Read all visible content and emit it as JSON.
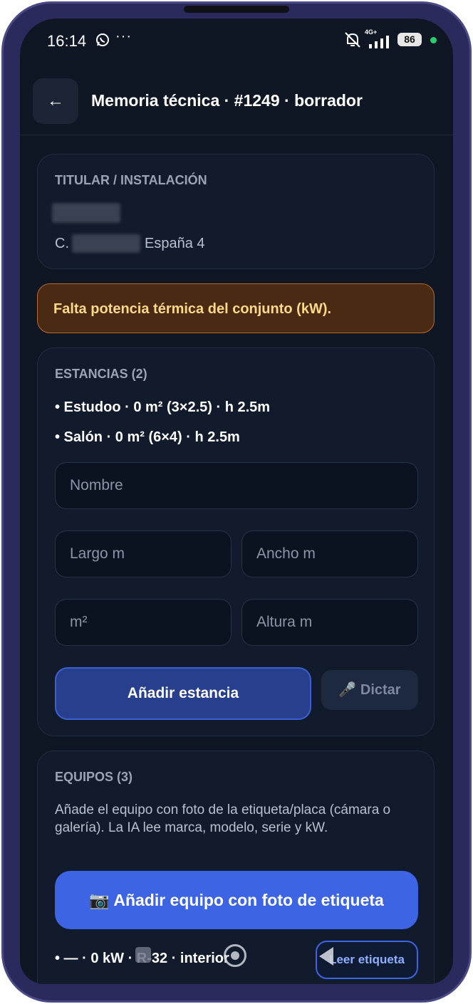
{
  "status_bar": {
    "time": "16:14",
    "more": "···",
    "network": "4G+",
    "battery": "86"
  },
  "header": {
    "back_label": "←",
    "title": "Memoria técnica · #1249 · borrador"
  },
  "titular": {
    "section_label": "TITULAR / INSTALACIÓN",
    "address_prefix": "C.",
    "address_suffix": "España 4"
  },
  "warning": {
    "text": "Falta potencia térmica del conjunto (kW)."
  },
  "estancias": {
    "section_label": "ESTANCIAS (2)",
    "rooms": [
      "• Estudoo · 0 m² (3×2.5) · h 2.5m",
      "• Salón · 0 m² (6×4) · h 2.5m"
    ],
    "inputs": {
      "nombre": "Nombre",
      "largo": "Largo m",
      "ancho": "Ancho m",
      "m2": "m²",
      "altura": "Altura m"
    },
    "add_button": "Añadir estancia",
    "dictar_button": "🎤 Dictar"
  },
  "equipos": {
    "section_label": "EQUIPOS (3)",
    "description": "Añade el equipo con foto de la etiqueta/placa (cámara o galería). La IA lee marca, modelo, serie y kW.",
    "photo_button": "📷 Añadir equipo con foto de etiqueta",
    "item_text": "• —  · 0 kW · R-32 · interior",
    "read_label_button": "Leer etiqueta"
  },
  "colors": {
    "background": "#0f1624",
    "card": "#121b2b",
    "accent": "#3c64e3",
    "warning_bg": "#4a2a12",
    "warning_text": "#fbd98a"
  }
}
